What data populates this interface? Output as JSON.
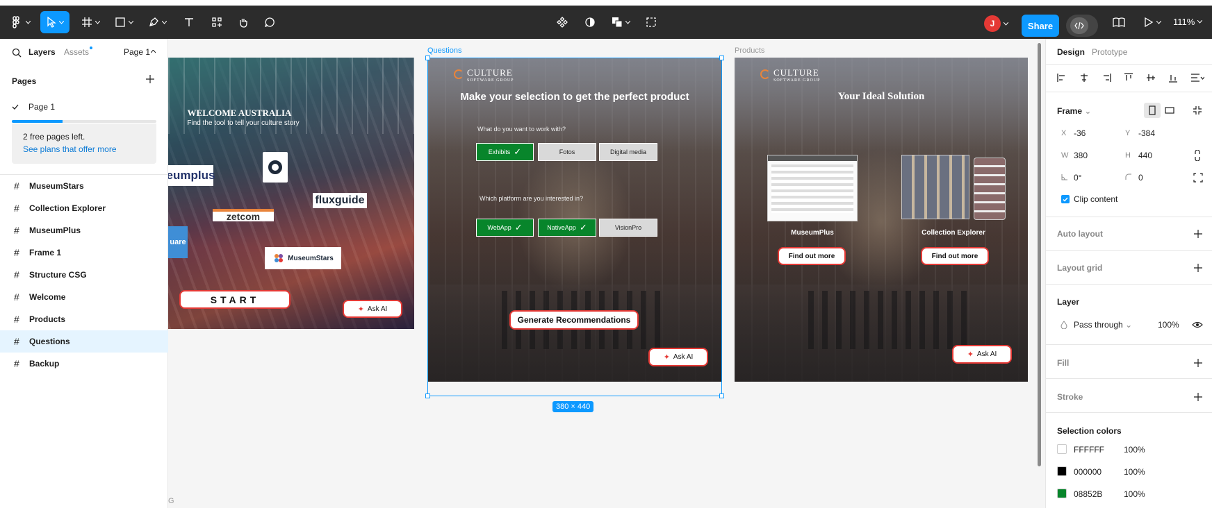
{
  "toolbar": {
    "zoom": "111%",
    "share_label": "Share",
    "avatar_initial": "J",
    "avatar_color": "#e53935",
    "accent_color": "#0d99ff"
  },
  "left_panel": {
    "tabs": [
      "Layers",
      "Assets"
    ],
    "page_selector": "Page 1",
    "pages_title": "Pages",
    "current_page": "Page 1",
    "free_pages_progress": 0.35,
    "plan_text": "2 free pages left.",
    "plan_link": "See plans that offer more",
    "layers": [
      {
        "label": "MuseumStars",
        "selected": false
      },
      {
        "label": "Collection Explorer",
        "selected": false
      },
      {
        "label": "MuseumPlus",
        "selected": false
      },
      {
        "label": "Frame 1",
        "selected": false
      },
      {
        "label": "Structure CSG",
        "selected": false
      },
      {
        "label": "Welcome",
        "selected": false
      },
      {
        "label": "Products",
        "selected": false
      },
      {
        "label": "Questions",
        "selected": true
      },
      {
        "label": "Backup",
        "selected": false
      }
    ]
  },
  "canvas": {
    "frame_labels": {
      "questions": "Questions",
      "products": "Products"
    },
    "selection_size": "380 × 440",
    "corner_letter": "G",
    "welcome": {
      "title": "WELCOME AUSTRALIA",
      "subtitle": "Find the tool to tell your culture story",
      "brands": [
        "eumplus",
        "fluxguide",
        "zetcom",
        "uare",
        "MuseumStars"
      ],
      "start_label": "START",
      "ask_label": "Ask AI"
    },
    "questions": {
      "logo_big": "CULTURE",
      "logo_small": "SOFTWARE GROUP",
      "heading": "Make your selection to get the perfect product",
      "q1": "What do you want to work with?",
      "q1_options": [
        {
          "label": "Exhibits",
          "on": true
        },
        {
          "label": "Fotos",
          "on": false
        },
        {
          "label": "Digital media",
          "on": false
        }
      ],
      "q2": "Which platform are you interested in?",
      "q2_options": [
        {
          "label": "WebApp",
          "on": true
        },
        {
          "label": "NativeApp",
          "on": true
        },
        {
          "label": "VisionPro",
          "on": false
        }
      ],
      "check": "✓",
      "generate_label": "Generate Recommendations",
      "ask_label": "Ask AI"
    },
    "products": {
      "logo_big": "CULTURE",
      "logo_small": "SOFTWARE GROUP",
      "heading": "Your Ideal Solution",
      "items": [
        {
          "name": "MuseumPlus",
          "cta": "Find out more"
        },
        {
          "name": "Collection Explorer",
          "cta": "Find out more"
        }
      ],
      "ask_label": "Ask AI"
    }
  },
  "right_panel": {
    "tabs": [
      "Design",
      "Prototype"
    ],
    "frame_label": "Frame",
    "x_label": "X",
    "x": "-36",
    "y_label": "Y",
    "y": "-384",
    "w_label": "W",
    "w": "380",
    "h_label": "H",
    "h": "440",
    "rotation": "0°",
    "radius": "0",
    "clip_content": "Clip content",
    "auto_layout": "Auto layout",
    "layout_grid": "Layout grid",
    "layer_title": "Layer",
    "blend_mode": "Pass through",
    "opacity": "100%",
    "fill": "Fill",
    "stroke": "Stroke",
    "selection_colors_title": "Selection colors",
    "colors": [
      {
        "hex": "FFFFFF",
        "swatch": "#FFFFFF",
        "opacity": "100%"
      },
      {
        "hex": "000000",
        "swatch": "#000000",
        "opacity": "100%"
      },
      {
        "hex": "08852B",
        "swatch": "#08852B",
        "opacity": "100%"
      }
    ]
  }
}
